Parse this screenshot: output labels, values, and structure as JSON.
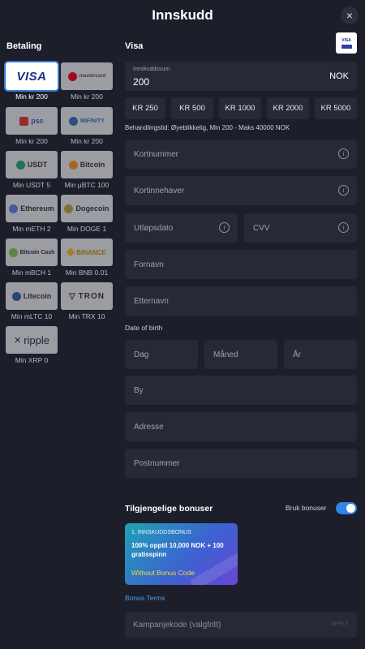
{
  "header": {
    "title": "Innskudd",
    "close_label": "×"
  },
  "left": {
    "heading": "Betaling"
  },
  "methods": [
    {
      "id": "visa",
      "logo": "VISA",
      "label": "Min kr 200",
      "active": true
    },
    {
      "id": "mastercard",
      "logo": "mastercard",
      "label": "Min kr 200"
    },
    {
      "id": "paysafecard",
      "logo": "psc",
      "label": "Min kr 200"
    },
    {
      "id": "mifinity",
      "logo": "MIFINITY",
      "label": "Min kr 200"
    },
    {
      "id": "usdt",
      "logo": "USDT",
      "label": "Min USDT 5"
    },
    {
      "id": "bitcoin",
      "logo": "Bitcoin",
      "label": "Min µBTC 100"
    },
    {
      "id": "ethereum",
      "logo": "Ethereum",
      "label": "Min mETH 2"
    },
    {
      "id": "dogecoin",
      "logo": "Dogecoin",
      "label": "Min DOGE 1"
    },
    {
      "id": "bitcoin-cash",
      "logo": "Bitcoin Cash",
      "label": "Min mBCH 1"
    },
    {
      "id": "binance",
      "logo": "BINANCE",
      "label": "Min BNB 0.01"
    },
    {
      "id": "litecoin",
      "logo": "Litecoin",
      "label": "Min mLTC 10"
    },
    {
      "id": "tron",
      "logo": "TRON",
      "label": "Min TRX 10"
    },
    {
      "id": "ripple",
      "logo": "ripple",
      "label": "Min XRP 0"
    }
  ],
  "right": {
    "heading": "Visa",
    "badge": "VISA"
  },
  "amount": {
    "label": "Innskuddssum",
    "value": "200",
    "currency": "NOK"
  },
  "presets": [
    "KR 250",
    "KR 500",
    "KR 1000",
    "KR 2000",
    "KR 5000"
  ],
  "processing": "Behandlingstid: Øyeblikkelig, Min 200 - Maks 40000 NOK",
  "fields": {
    "card_number": "Kortnummer",
    "card_holder": "Kortinnehaver",
    "expiry": "Utløpsdato",
    "cvv": "CVV",
    "first_name": "Fornavn",
    "last_name": "Etternavn",
    "dob_label": "Date of birth",
    "day": "Dag",
    "month": "Måned",
    "year": "År",
    "city": "By",
    "address": "Adresse",
    "postcode": "Postnummer"
  },
  "bonus": {
    "heading": "Tilgjengelige bonuser",
    "use_label": "Bruk bonuser",
    "toggle_on": true,
    "card_tag": "1. INNSKUDDSBONUS",
    "card_title": "100% opptil 10,000 NOK + 100 gratisspinn",
    "card_code": "Without Bonus Code",
    "terms": "Bonus Terms"
  },
  "promo": {
    "placeholder": "Kampanjekode (valgfritt)",
    "apply": "APPLY"
  },
  "colors": {
    "background": "#1c1f2a",
    "field": "#262a36",
    "accent": "#2f86e8",
    "link": "#4e9cf0",
    "bonus_code": "#f4d93b"
  }
}
